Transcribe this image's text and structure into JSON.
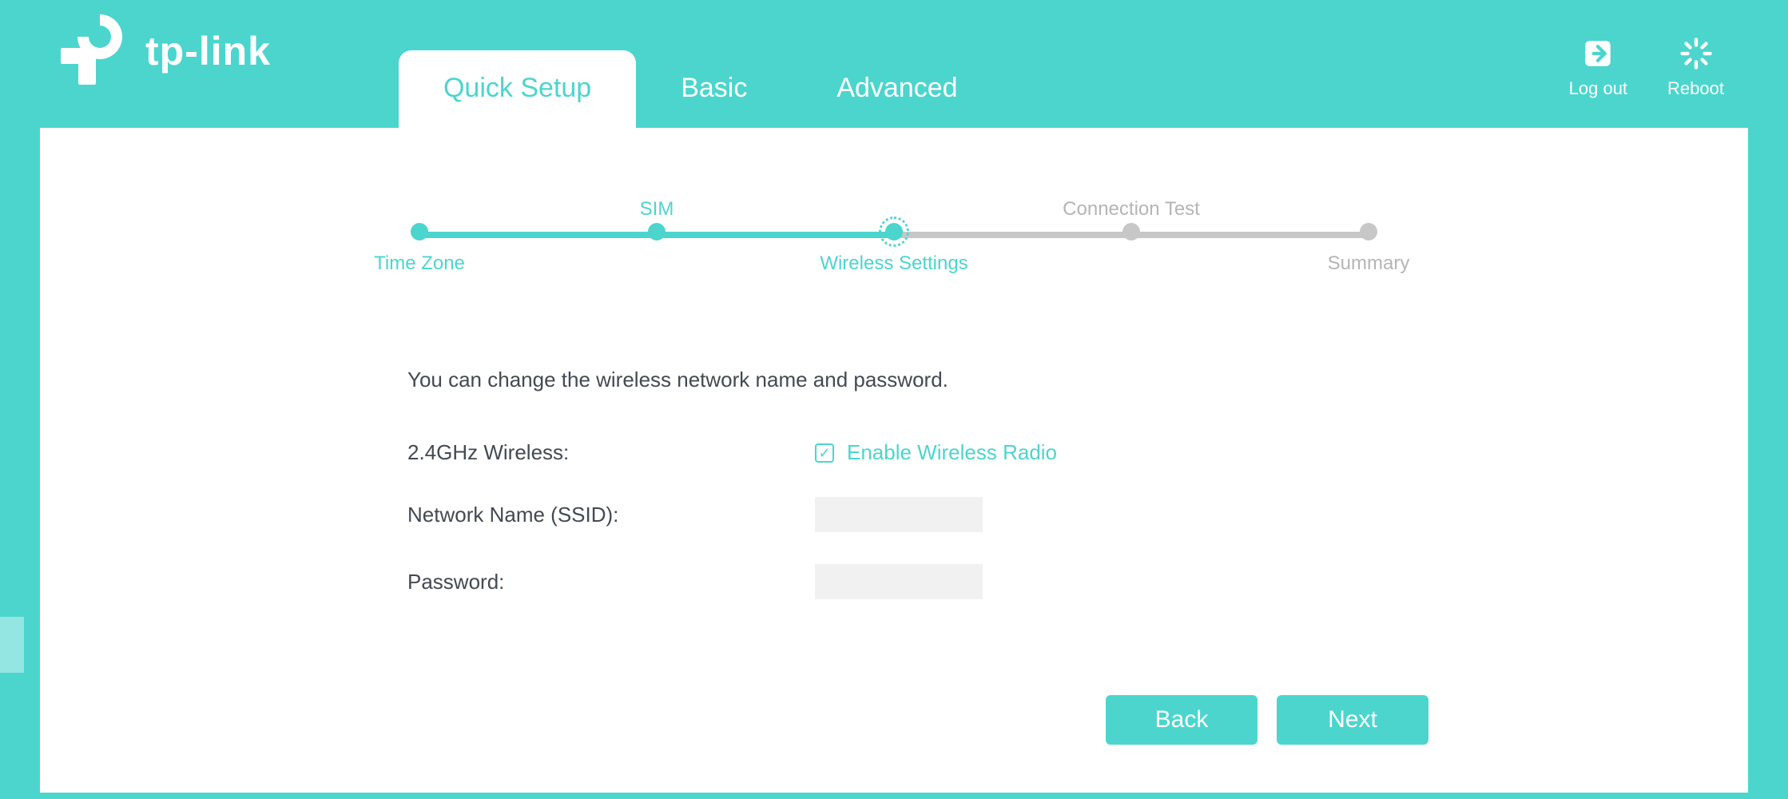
{
  "brand": {
    "name": "tp-link"
  },
  "tabs": [
    {
      "label": "Quick Setup",
      "active": true
    },
    {
      "label": "Basic",
      "active": false
    },
    {
      "label": "Advanced",
      "active": false
    }
  ],
  "header_actions": {
    "logout": "Log out",
    "reboot": "Reboot"
  },
  "wizard": {
    "steps": [
      {
        "label": "Time Zone",
        "pos": "bottom",
        "state": "done"
      },
      {
        "label": "SIM",
        "pos": "top",
        "state": "done"
      },
      {
        "label": "Wireless Settings",
        "pos": "bottom",
        "state": "current"
      },
      {
        "label": "Connection Test",
        "pos": "top",
        "state": "pending"
      },
      {
        "label": "Summary",
        "pos": "bottom",
        "state": "pending"
      }
    ]
  },
  "form": {
    "intro": "You can change the wireless network name and password.",
    "rows": {
      "wifi24": {
        "label": "2.4GHz Wireless:",
        "checkbox_label": "Enable Wireless Radio",
        "checked": true
      },
      "ssid": {
        "label": "Network Name (SSID):",
        "value": ""
      },
      "password": {
        "label": "Password:",
        "value": ""
      }
    }
  },
  "buttons": {
    "back": "Back",
    "next": "Next"
  }
}
